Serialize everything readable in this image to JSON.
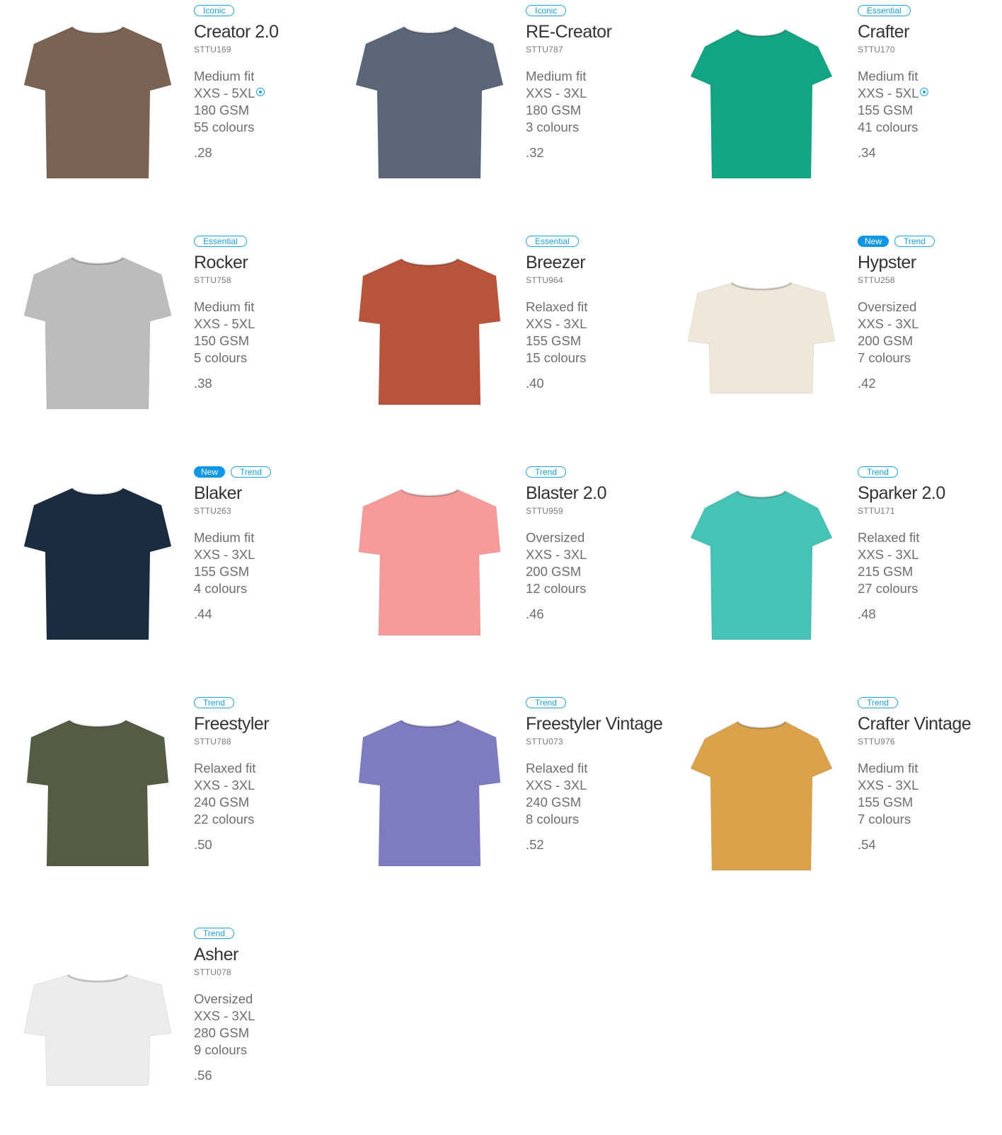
{
  "products": [
    {
      "name": "Creator 2.0",
      "code": "STTU169",
      "badges": [
        {
          "label": "Iconic",
          "type": "outline"
        }
      ],
      "fit": "Medium fit",
      "sizes": "XXS - 5XL",
      "eco": true,
      "gsm": "180 GSM",
      "colours": "55 colours",
      "price": ".28",
      "color": "#7b6354",
      "shape": "regular"
    },
    {
      "name": "RE-Creator",
      "code": "STTU787",
      "badges": [
        {
          "label": "Iconic",
          "type": "outline"
        }
      ],
      "fit": "Medium fit",
      "sizes": "XXS - 3XL",
      "eco": false,
      "gsm": "180 GSM",
      "colours": "3 colours",
      "price": ".32",
      "color": "#5b6678",
      "shape": "regular"
    },
    {
      "name": "Crafter",
      "code": "STTU170",
      "badges": [
        {
          "label": "Essential",
          "type": "outline"
        }
      ],
      "fit": "Medium fit",
      "sizes": "XXS - 5XL",
      "eco": true,
      "gsm": "155 GSM",
      "colours": "41 colours",
      "price": ".34",
      "color": "#12a584",
      "shape": "slim"
    },
    {
      "name": "Rocker",
      "code": "STTU758",
      "badges": [
        {
          "label": "Essential",
          "type": "outline"
        }
      ],
      "fit": "Medium fit",
      "sizes": "XXS - 5XL",
      "eco": false,
      "gsm": "150 GSM",
      "colours": "5 colours",
      "price": ".38",
      "color": "#bcbcbc",
      "shape": "regular"
    },
    {
      "name": "Breezer",
      "code": "STTU964",
      "badges": [
        {
          "label": "Essential",
          "type": "outline"
        }
      ],
      "fit": "Relaxed fit",
      "sizes": "XXS - 3XL",
      "eco": false,
      "gsm": "155 GSM",
      "colours": "15 colours",
      "price": ".40",
      "color": "#b9543c",
      "shape": "relaxed"
    },
    {
      "name": "Hypster",
      "code": "STTU258",
      "badges": [
        {
          "label": "New",
          "type": "filled"
        },
        {
          "label": "Trend",
          "type": "outline"
        }
      ],
      "fit": "Oversized",
      "sizes": "XXS - 3XL",
      "eco": false,
      "gsm": "200 GSM",
      "colours": "7 colours",
      "price": ".42",
      "color": "#efe7d9",
      "shape": "oversized"
    },
    {
      "name": "Blaker",
      "code": "STTU263",
      "badges": [
        {
          "label": "New",
          "type": "filled"
        },
        {
          "label": "Trend",
          "type": "outline"
        }
      ],
      "fit": "Medium fit",
      "sizes": "XXS - 3XL",
      "eco": false,
      "gsm": "155 GSM",
      "colours": "4 colours",
      "price": ".44",
      "color": "#1b2b40",
      "shape": "regular"
    },
    {
      "name": "Blaster 2.0",
      "code": "STTU959",
      "badges": [
        {
          "label": "Trend",
          "type": "outline"
        }
      ],
      "fit": "Oversized",
      "sizes": "XXS - 3XL",
      "eco": false,
      "gsm": "200 GSM",
      "colours": "12 colours",
      "price": ".46",
      "color": "#f79a9a",
      "shape": "relaxed"
    },
    {
      "name": "Sparker 2.0",
      "code": "STTU171",
      "badges": [
        {
          "label": "Trend",
          "type": "outline"
        }
      ],
      "fit": "Relaxed fit",
      "sizes": "XXS - 3XL",
      "eco": false,
      "gsm": "215 GSM",
      "colours": "27 colours",
      "price": ".48",
      "color": "#46c3b4",
      "shape": "slim"
    },
    {
      "name": "Freestyler",
      "code": "STTU788",
      "badges": [
        {
          "label": "Trend",
          "type": "outline"
        }
      ],
      "fit": "Relaxed fit",
      "sizes": "XXS - 3XL",
      "eco": false,
      "gsm": "240 GSM",
      "colours": "22 colours",
      "price": ".50",
      "color": "#545c43",
      "shape": "relaxed"
    },
    {
      "name": "Freestyler Vintage",
      "code": "STTU073",
      "badges": [
        {
          "label": "Trend",
          "type": "outline"
        }
      ],
      "fit": "Relaxed fit",
      "sizes": "XXS - 3XL",
      "eco": false,
      "gsm": "240 GSM",
      "colours": "8 colours",
      "price": ".52",
      "color": "#7d7cc1",
      "shape": "relaxed"
    },
    {
      "name": "Crafter Vintage",
      "code": "STTU976",
      "badges": [
        {
          "label": "Trend",
          "type": "outline"
        }
      ],
      "fit": "Medium fit",
      "sizes": "XXS - 3XL",
      "eco": false,
      "gsm": "155 GSM",
      "colours": "7 colours",
      "price": ".54",
      "color": "#daa24b",
      "shape": "slim"
    },
    {
      "name": "Asher",
      "code": "STTU078",
      "badges": [
        {
          "label": "Trend",
          "type": "outline"
        }
      ],
      "fit": "Oversized",
      "sizes": "XXS - 3XL",
      "eco": false,
      "gsm": "280 GSM",
      "colours": "9 colours",
      "price": ".56",
      "color": "#ececec",
      "shape": "oversized"
    }
  ]
}
